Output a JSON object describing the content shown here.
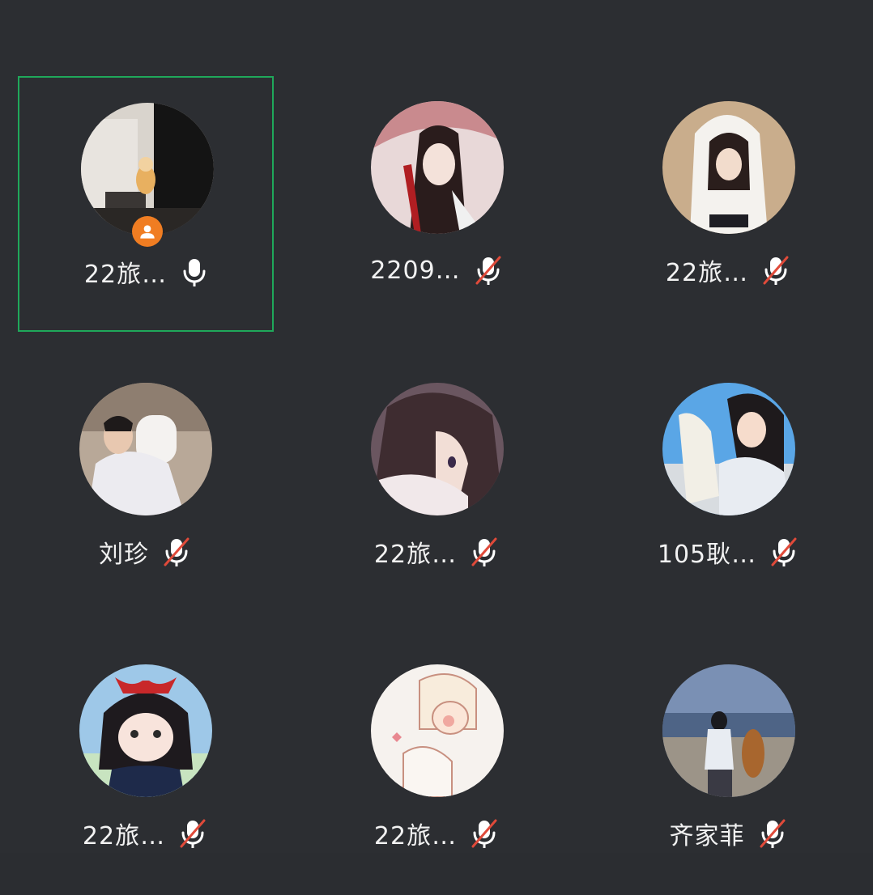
{
  "participants": [
    {
      "name": "22旅…",
      "mic": "mic-on-icon",
      "host": true,
      "active": true
    },
    {
      "name": "2209…",
      "mic": "mic-muted-icon",
      "host": false,
      "active": false
    },
    {
      "name": "22旅…",
      "mic": "mic-muted-icon",
      "host": false,
      "active": false
    },
    {
      "name": "刘珍",
      "mic": "mic-muted-icon",
      "host": false,
      "active": false
    },
    {
      "name": "22旅…",
      "mic": "mic-muted-icon",
      "host": false,
      "active": false
    },
    {
      "name": "105耿…",
      "mic": "mic-muted-icon",
      "host": false,
      "active": false
    },
    {
      "name": "22旅…",
      "mic": "mic-muted-icon",
      "host": false,
      "active": false
    },
    {
      "name": "22旅…",
      "mic": "mic-muted-icon",
      "host": false,
      "active": false
    },
    {
      "name": "齐家菲",
      "mic": "mic-muted-icon",
      "host": false,
      "active": false
    }
  ],
  "colors": {
    "background": "#2c2e32",
    "active_border": "#1fa85a",
    "host_badge": "#f07d22",
    "mute_slash": "#e04a3a",
    "text": "#f2f2f2"
  }
}
